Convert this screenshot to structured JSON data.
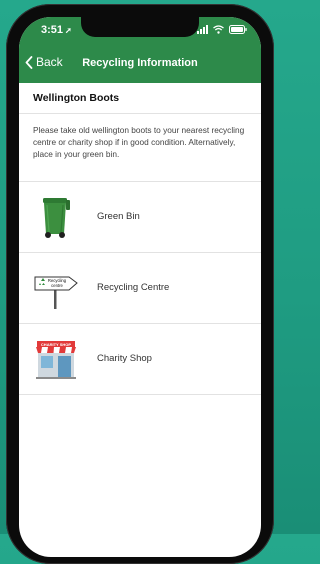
{
  "status": {
    "time": "3:51"
  },
  "nav": {
    "back_label": "Back",
    "title": "Recycling Information"
  },
  "item": {
    "title": "Wellington Boots",
    "description": "Please take old wellington boots to your nearest recycling centre or charity shop if in good condition. Alternatively, place in your green bin."
  },
  "options": [
    {
      "label": "Green Bin",
      "icon": "green-bin-icon"
    },
    {
      "label": "Recycling Centre",
      "icon": "recycling-centre-sign-icon",
      "sign_text": "Recycling centre"
    },
    {
      "label": "Charity Shop",
      "icon": "charity-shop-icon",
      "sign_text": "CHARITY SHOP"
    }
  ],
  "colors": {
    "header_green": "#2d8a4a",
    "background_teal": "#22a387",
    "bin_green": "#3c8f3f"
  }
}
